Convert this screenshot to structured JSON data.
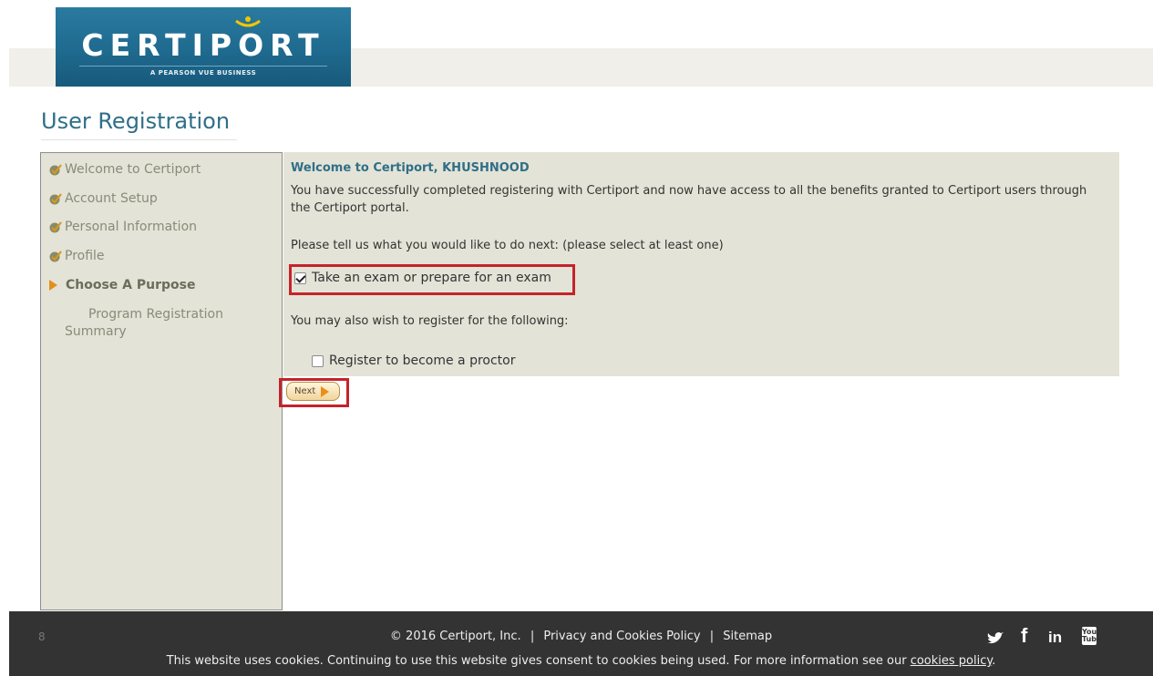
{
  "logo": {
    "word": "CERTIPORT",
    "tagline": "A PEARSON VUE BUSINESS"
  },
  "page": {
    "title": "User Registration"
  },
  "sidebar": {
    "steps": [
      {
        "label": "Welcome to Certiport"
      },
      {
        "label": "Account Setup"
      },
      {
        "label": "Personal Information"
      },
      {
        "label": "Profile"
      },
      {
        "label": "Choose A Purpose"
      },
      {
        "label": "Program Registration Summary"
      }
    ]
  },
  "content": {
    "welcome": "Welcome to Certiport, KHUSHNOOD",
    "intro": "You have successfully completed registering with Certiport and now have access to all the benefits granted to Certiport users through the Certiport portal.",
    "prompt": "Please tell us what you would like to do next: (please select at least one)",
    "option_exam": {
      "label": "Take an exam or prepare for an exam",
      "checked": true
    },
    "also": "You may also wish to register for the following:",
    "option_proctor": {
      "label": "Register to become a proctor",
      "checked": false
    },
    "next_label": "Next"
  },
  "footer": {
    "page_num": "8",
    "copyright": "© 2016 Certiport, Inc.",
    "sep": "|",
    "privacy": "Privacy and Cookies Policy",
    "sitemap": "Sitemap",
    "cookie_text": "This website uses cookies. Continuing to use this website gives consent to cookies being used. For more information see our",
    "cookie_link": "cookies policy",
    "cookie_end": ".",
    "social": {
      "facebook": "f",
      "linkedin": "in",
      "youtube": "You Tube"
    }
  },
  "colors": {
    "accent": "#2f6f88",
    "highlight": "#c4232b",
    "panel": "#e4e3d7",
    "footer": "#333333"
  }
}
